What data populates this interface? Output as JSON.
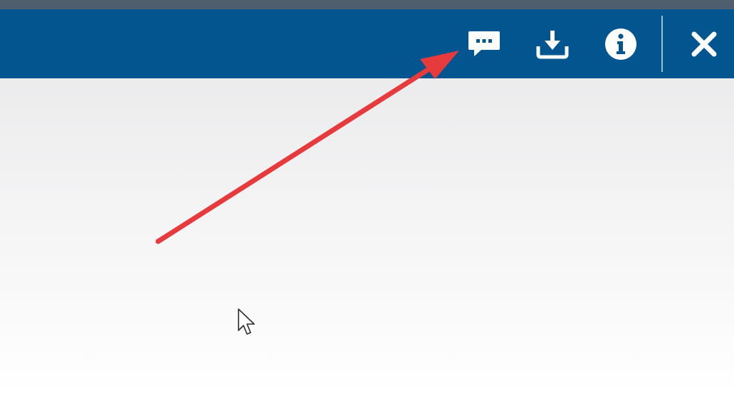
{
  "toolbar": {
    "background_color": "#02558e",
    "icon_color": "#ffffff",
    "buttons": [
      {
        "name": "comments",
        "icon": "comment-dots-icon"
      },
      {
        "name": "download",
        "icon": "download-icon"
      },
      {
        "name": "info",
        "icon": "info-icon"
      },
      {
        "name": "close",
        "icon": "close-icon"
      }
    ]
  },
  "annotation": {
    "type": "arrow",
    "color": "#e63a3c",
    "points_to": "comments-button"
  },
  "cursor": {
    "icon": "mouse-pointer-icon"
  }
}
